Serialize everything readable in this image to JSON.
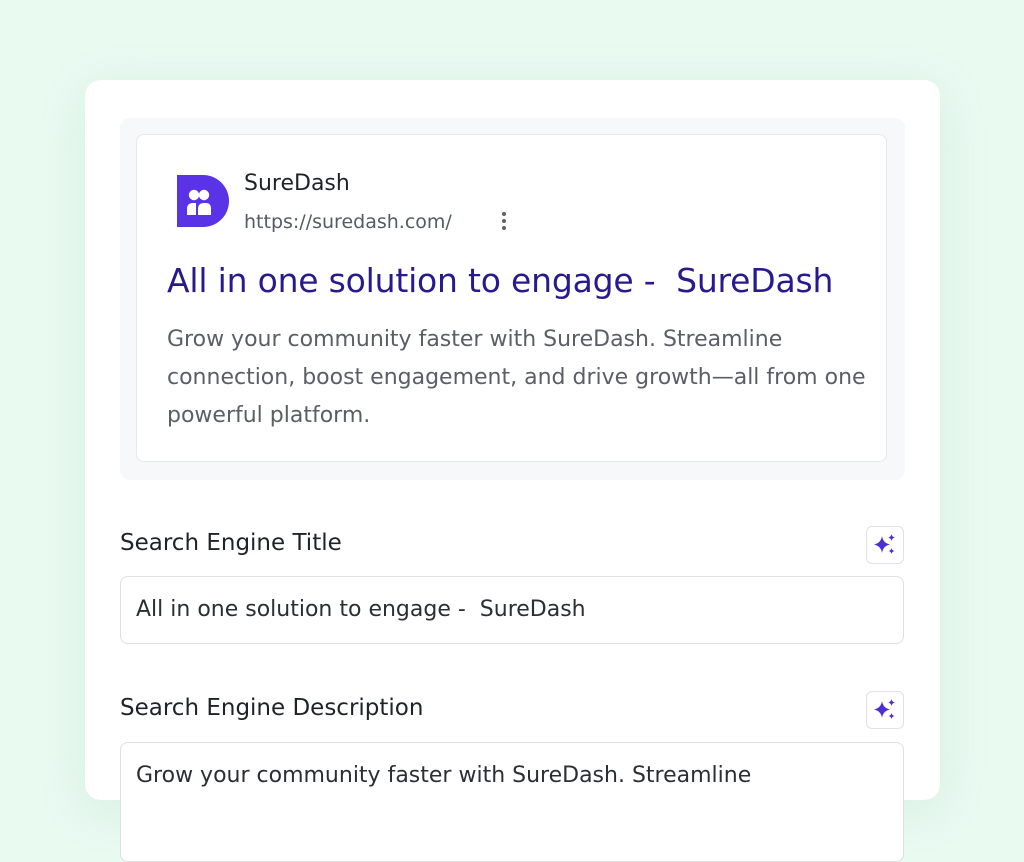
{
  "preview": {
    "site_name": "SureDash",
    "site_url": "https://suredash.com/",
    "title": "All in one solution to engage -  SureDash",
    "description": "Grow your community faster with SureDash. Streamline connection, boost engagement, and drive growth—all from one powerful platform."
  },
  "fields": {
    "title_label": "Search Engine Title",
    "title_value": "All in one solution to engage -  SureDash",
    "description_label": "Search Engine Description",
    "description_value": "Grow your community faster with SureDash. Streamline"
  },
  "icons": {
    "logo": "suredash-logo",
    "more": "kebab-menu-icon",
    "ai": "sparkles-icon"
  },
  "colors": {
    "brand": "#5b33e6",
    "serp_title": "#281a8e",
    "background": "#e9faf1"
  }
}
